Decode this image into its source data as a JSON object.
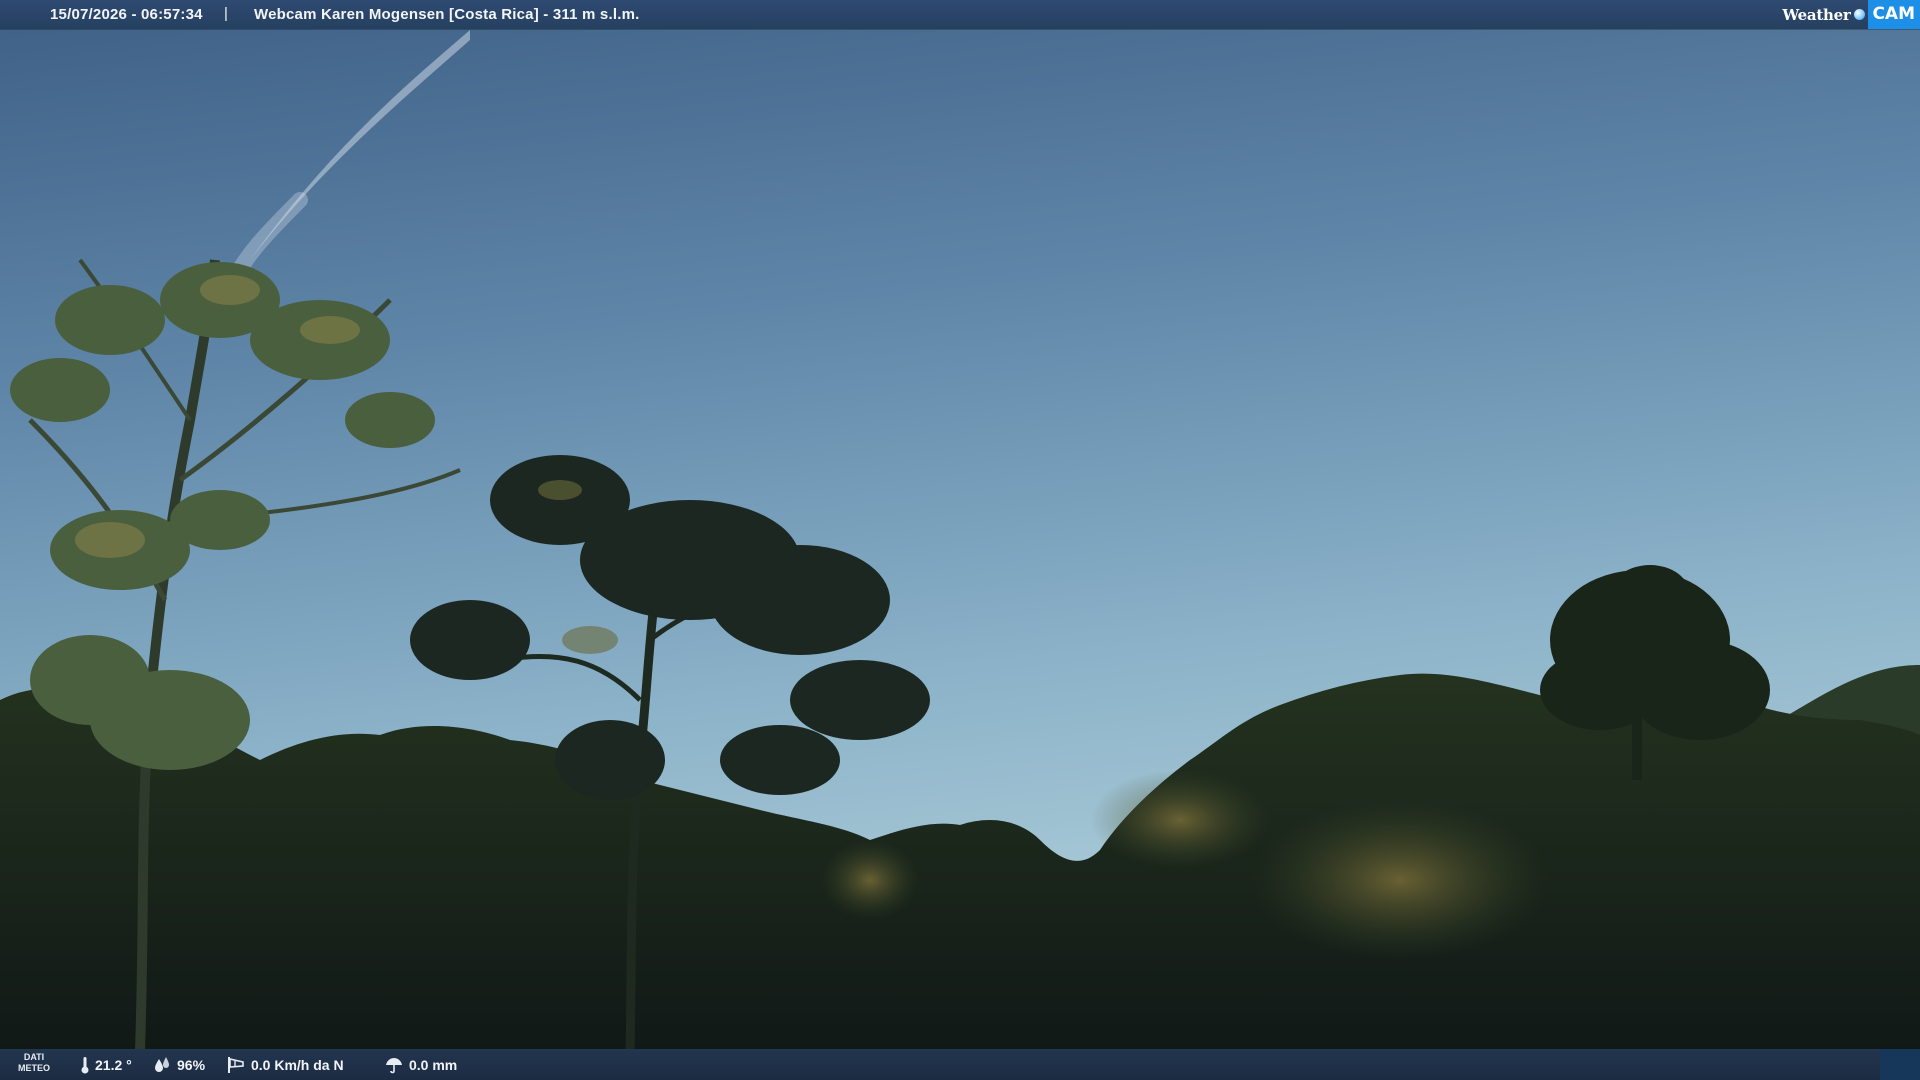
{
  "header": {
    "datetime": "15/07/2026 - 06:57:34",
    "separator": "|",
    "title": "Webcam Karen Mogensen [Costa Rica]  - 311 m s.l.m.",
    "logo_left": "Weather",
    "logo_right": "CAM"
  },
  "footer": {
    "label_line1": "DATI",
    "label_line2": "METEO",
    "temperature": "21.2 °",
    "humidity": "96%",
    "wind": "0.0 Km/h da N",
    "rain": "0.0 mm"
  },
  "icons": {
    "temperature": "thermometer-icon",
    "humidity": "humidity-drops-icon",
    "wind": "wind-sock-icon",
    "rain": "rain-umbrella-icon"
  },
  "colors": {
    "bar": "#2f4a72",
    "logo_accent": "#1e8fe6",
    "sky_top": "#4b6c8f",
    "sky_horizon": "#a6c9d8",
    "foliage": "#1d271d"
  }
}
